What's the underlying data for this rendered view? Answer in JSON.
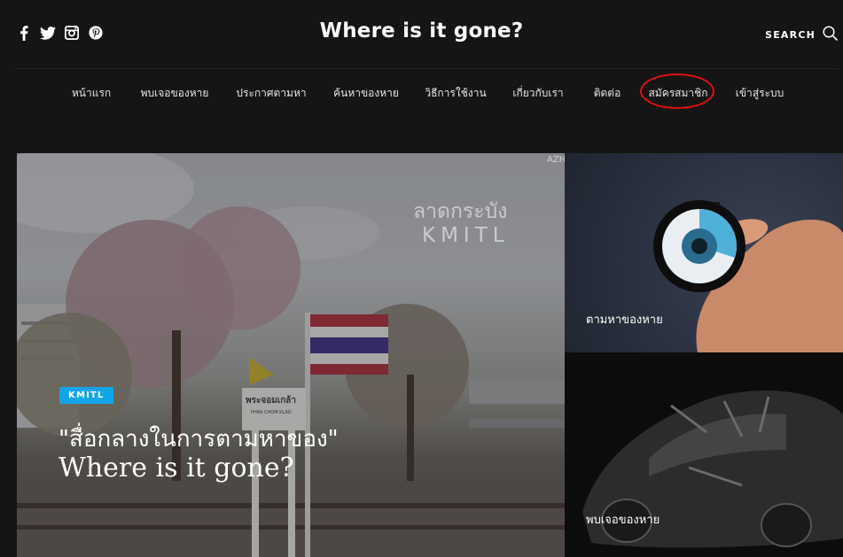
{
  "site": {
    "title": "Where is it gone?"
  },
  "social": [
    {
      "icon": "facebook-icon"
    },
    {
      "icon": "twitter-icon"
    },
    {
      "icon": "instagram-icon"
    },
    {
      "icon": "pinterest-icon"
    }
  ],
  "search": {
    "label": "SEARCH",
    "icon": "search-icon"
  },
  "nav": {
    "items": [
      {
        "label": "หน้าแรก"
      },
      {
        "label": "พบเจอของหาย"
      },
      {
        "label": "ประกาศตามหา"
      },
      {
        "label": "ค้นหาของหาย"
      },
      {
        "label": "วิธีการใช้งาน"
      },
      {
        "label": "เกี่ยวกับเรา"
      },
      {
        "label": "ติดต่อ"
      },
      {
        "label": "สมัครสมาชิก"
      },
      {
        "label": "เข้าสู่ระบบ"
      }
    ],
    "highlight_color": "#dd1111"
  },
  "hero": {
    "badge": "KMITL",
    "badge_color": "#12a5e8",
    "headline_th": "\"สื่อกลางในการตามหาของ\"",
    "headline_en": "Where is it gone?",
    "watermark_th": "ลาดกระบัง",
    "watermark_en": "KMITL",
    "corner_mark": "AZH",
    "sign_th": "พระจอมเกล้า",
    "sign_en": "PHRA CHOM KLAO"
  },
  "side_cards": [
    {
      "label": "ตามหาของหาย"
    },
    {
      "label": "พบเจอของหาย"
    }
  ]
}
